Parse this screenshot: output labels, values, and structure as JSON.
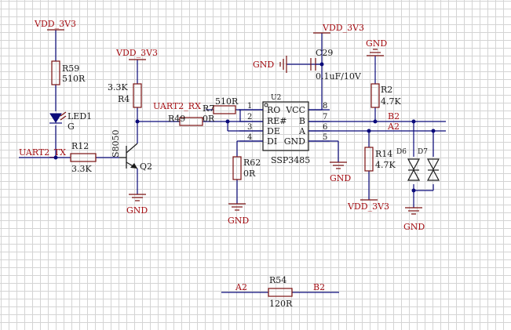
{
  "nets": {
    "vdd_top_left": "VDD_3V3",
    "vdd_q2": "VDD_3V3",
    "vdd_c29": "VDD_3V3",
    "vdd_r14": "VDD_3V3",
    "gnd_c29": "GND",
    "gnd_r2": "GND",
    "gnd_q2": "GND",
    "gnd_r62": "GND",
    "gnd_u2": "GND",
    "gnd_diodes": "GND",
    "uart2_tx": "UART2_TX",
    "uart2_rx": "UART2_RX",
    "b2_bus": "B2",
    "a2_bus": "A2",
    "a2_r54": "A2",
    "b2_r54": "B2"
  },
  "components": {
    "r59": {
      "ref": "R59",
      "value": "510R"
    },
    "led1": {
      "ref": "LED1",
      "value": "G"
    },
    "r12": {
      "ref": "R12",
      "value": "3.3K"
    },
    "q2": {
      "ref": "Q2",
      "value": "S8050"
    },
    "r4": {
      "ref": "R4",
      "value": "3.3K"
    },
    "r7": {
      "ref": "R7",
      "value": "510R"
    },
    "r49": {
      "ref": "R49",
      "value": "0R"
    },
    "r62": {
      "ref": "R62",
      "value": "0R"
    },
    "c29": {
      "ref": "C29",
      "value": "0.1uF/10V"
    },
    "r2": {
      "ref": "R2",
      "value": "4.7K"
    },
    "r14": {
      "ref": "R14",
      "value": "4.7K"
    },
    "d6": {
      "ref": "D6"
    },
    "d7": {
      "ref": "D7"
    },
    "r54": {
      "ref": "R54",
      "value": "120R"
    }
  },
  "u2": {
    "ref": "U2",
    "part": "SSP3485",
    "left_pins": [
      {
        "num": "1",
        "name": "RO"
      },
      {
        "num": "2",
        "name": "RE#"
      },
      {
        "num": "3",
        "name": "DE"
      },
      {
        "num": "4",
        "name": "DI"
      }
    ],
    "right_pins": [
      {
        "num": "8",
        "name": "VCC"
      },
      {
        "num": "7",
        "name": "B"
      },
      {
        "num": "6",
        "name": "A"
      },
      {
        "num": "5",
        "name": "GND"
      }
    ]
  }
}
